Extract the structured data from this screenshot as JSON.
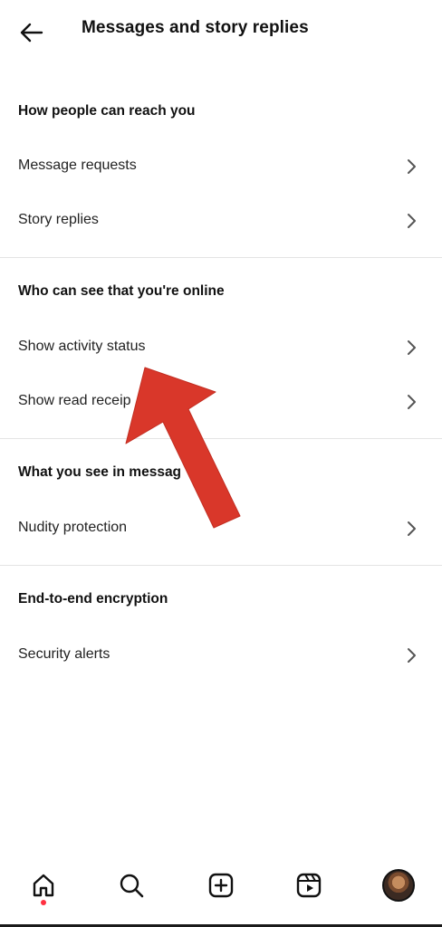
{
  "header": {
    "title": "Messages and story replies",
    "back_icon": "arrow-left-icon"
  },
  "sections": [
    {
      "heading": "How people can reach you",
      "items": [
        {
          "label": "Message requests"
        },
        {
          "label": "Story replies"
        }
      ]
    },
    {
      "heading": "Who can see that you're online",
      "items": [
        {
          "label": "Show activity status"
        },
        {
          "label": "Show read receip"
        }
      ]
    },
    {
      "heading": "What you see in messag",
      "items": [
        {
          "label": "Nudity protection"
        }
      ]
    },
    {
      "heading": "End-to-end encryption",
      "items": [
        {
          "label": "Security alerts"
        }
      ]
    }
  ],
  "annotation": {
    "arrow_color": "#e0392b"
  },
  "bottom_nav": {
    "items": [
      "home-icon",
      "search-icon",
      "create-icon",
      "reels-icon",
      "profile-avatar"
    ],
    "active_indicator_color": "#ff3040"
  }
}
